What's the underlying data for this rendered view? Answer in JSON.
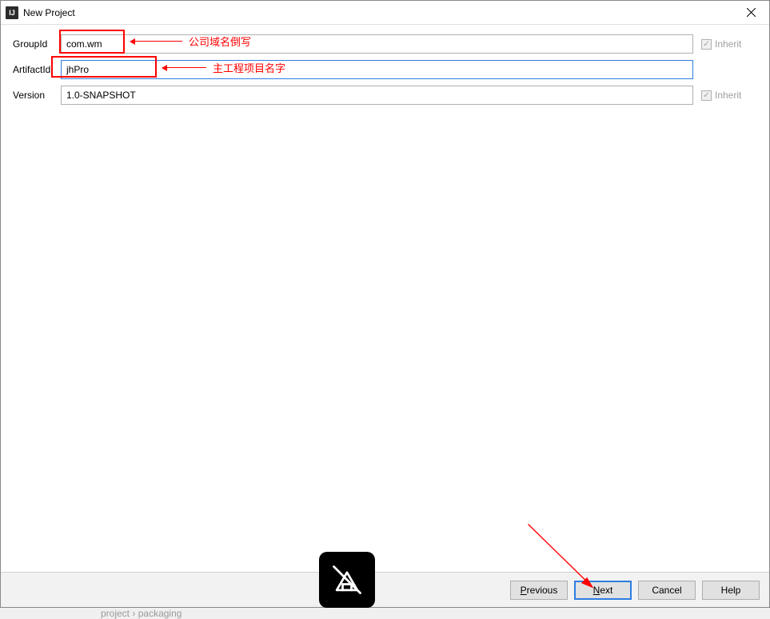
{
  "titlebar": {
    "title": "New Project",
    "icon_label": "IJ"
  },
  "form": {
    "group_id_label": "GroupId",
    "group_id_value": "com.wm",
    "artifact_id_label": "ArtifactId",
    "artifact_id_value": "jhPro",
    "version_label": "Version",
    "version_value": "1.0-SNAPSHOT",
    "inherit_label": "Inherit"
  },
  "annotations": {
    "group_id_note": "公司域名倒写",
    "artifact_id_note": "主工程项目名字"
  },
  "buttons": {
    "previous": "Previous",
    "next": "Next",
    "cancel": "Cancel",
    "help": "Help"
  },
  "breadcrumb": {
    "item1": "project",
    "item2": "packaging"
  }
}
